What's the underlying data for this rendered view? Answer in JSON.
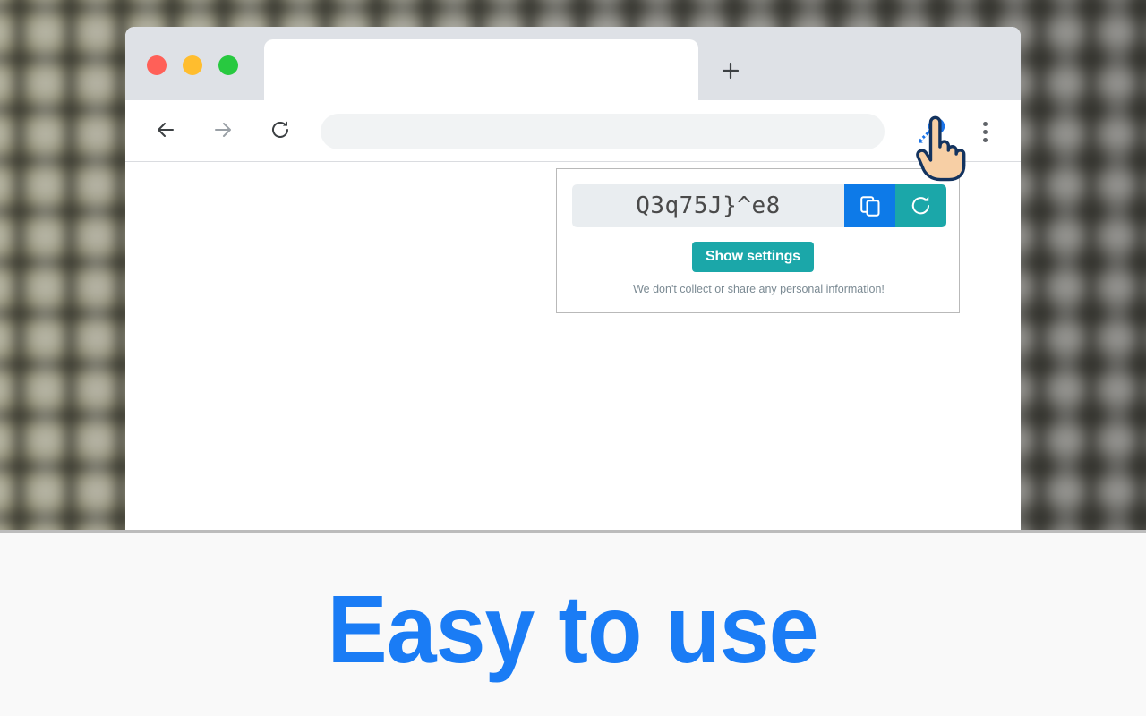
{
  "caption": {
    "text": "Easy to use",
    "color": "#1a7cf5"
  },
  "browser": {
    "window_controls": [
      {
        "name": "close",
        "color": "#ff6058"
      },
      {
        "name": "minimize",
        "color": "#ffbd2e"
      },
      {
        "name": "maximize",
        "color": "#28c940"
      }
    ],
    "tab": {
      "title": "",
      "new_tab_label": "+"
    },
    "toolbar": {
      "back_icon": "arrow-left-icon",
      "forward_icon": "arrow-right-icon",
      "reload_icon": "reload-icon",
      "address_value": "",
      "address_placeholder": "",
      "extension_icon": "key-icon",
      "extension_icon_color": "#1a73e8",
      "menu_icon": "kebab-menu-icon"
    }
  },
  "popup": {
    "password": "Q3q75J}^e8",
    "copy_button": {
      "icon": "copy-icon",
      "color": "#0d7ae8"
    },
    "refresh_button": {
      "icon": "refresh-icon",
      "color": "#1ba7a9"
    },
    "settings_label": "Show settings",
    "settings_color": "#1ba7a9",
    "privacy_note": "We don't collect or share any personal information!"
  },
  "cursor": {
    "icon": "pointing-hand-cursor",
    "skin_color": "#f7cfa5",
    "outline_color": "#13335f"
  }
}
